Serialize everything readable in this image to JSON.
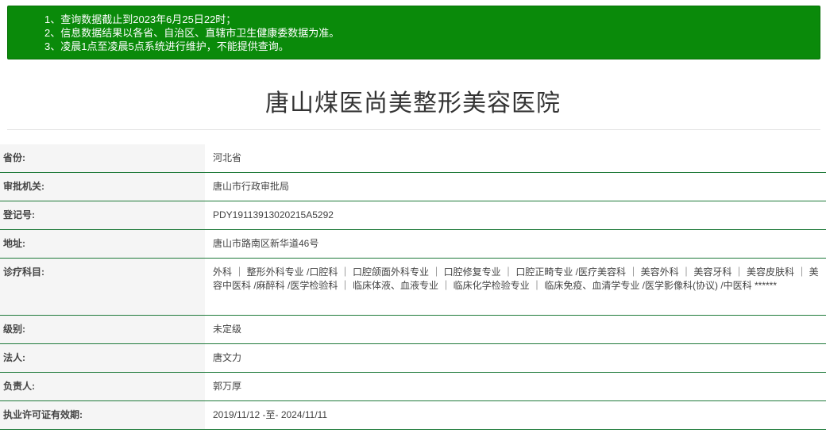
{
  "notice": {
    "lines": [
      "1、查询数据截止到2023年6月25日22时；",
      "2、信息数据结果以各省、自治区、直辖市卫生健康委数据为准。",
      "3、凌晨1点至凌晨5点系统进行维护，不能提供查询。"
    ],
    "background": "#0a8a0a"
  },
  "page_title": "唐山煤医尚美整形美容医院",
  "fields": [
    {
      "label": "省份:",
      "value": "河北省"
    },
    {
      "label": "审批机关:",
      "value": "唐山市行政审批局"
    },
    {
      "label": "登记号:",
      "value": "PDY19113913020215A5292"
    },
    {
      "label": "地址:",
      "value": "唐山市路南区新华道46号"
    },
    {
      "label": "诊疗科目:",
      "value": "外科 ｜ 整形外科专业 /口腔科 ｜ 口腔颌面外科专业 ｜ 口腔修复专业 ｜ 口腔正畸专业 /医疗美容科 ｜ 美容外科 ｜ 美容牙科 ｜ 美容皮肤科 ｜ 美容中医科 /麻醉科 /医学检验科 ｜ 临床体液、血液专业 ｜ 临床化学检验专业 ｜ 临床免疫、血清学专业 /医学影像科(协议) /中医科 ******"
    },
    {
      "label": "级别:",
      "value": "未定级"
    },
    {
      "label": "法人:",
      "value": "唐文力"
    },
    {
      "label": "负责人:",
      "value": "郭万厚"
    },
    {
      "label": "执业许可证有效期:",
      "value": "2019/11/12 -至- 2024/11/11"
    }
  ],
  "colors": {
    "row_border": "#1f7a3a",
    "label_bg": "#f5f5f5"
  }
}
